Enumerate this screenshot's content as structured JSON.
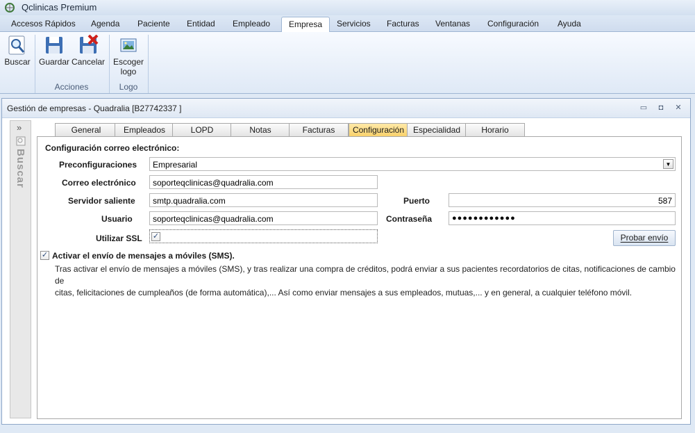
{
  "app": {
    "title": "Qclinicas Premium"
  },
  "menu": [
    "Accesos Rápidos",
    "Agenda",
    "Paciente",
    "Entidad",
    "Empleado",
    "Empresa",
    "Servicios",
    "Facturas",
    "Ventanas",
    "Configuración",
    "Ayuda"
  ],
  "ribbon": {
    "buscar": "Buscar",
    "guardar": "Guardar",
    "cancelar": "Cancelar",
    "escoger_line1": "Escoger",
    "escoger_line2": "logo",
    "group_acciones": "Acciones",
    "group_logo": "Logo"
  },
  "doc": {
    "title": "Gestión de empresas - Quadralia  [B27742337 ]",
    "side_label": "Buscar",
    "side_arrows": "»"
  },
  "tabs": [
    "General",
    "Empleados",
    "LOPD",
    "Notas",
    "Facturas",
    "Configuración",
    "Especialidad",
    "Horario"
  ],
  "form": {
    "section_title": "Configuración correo electrónico:",
    "preconf_label": "Preconfiguraciones",
    "preconf_value": "Empresarial",
    "correo_label": "Correo electrónico",
    "correo_value": "soporteqclinicas@quadralia.com",
    "servidor_label": "Servidor saliente",
    "servidor_value": "smtp.quadralia.com",
    "puerto_label": "Puerto",
    "puerto_value": "587",
    "usuario_label": "Usuario",
    "usuario_value": "soporteqclinicas@quadralia.com",
    "contrasena_label": "Contraseña",
    "contrasena_value": "●●●●●●●●●●●●",
    "ssl_label": "Utilizar SSL",
    "probar_label": "Probar envío",
    "sms_label": "Activar el envío de mensajes a móviles (SMS).",
    "sms_info_line1": "Tras activar el envío de mensajes a móviles (SMS), y tras realizar una compra de créditos, podrá enviar a sus pacientes recordatorios de citas, notificaciones de cambio de",
    "sms_info_line2": "citas, felicitaciones de cumpleaños (de forma automática),... Así como enviar mensajes a sus empleados, mutuas,... y en general, a cualquier teléfono móvil."
  },
  "check_mark": "✓",
  "colors": {
    "active_tab": "#f9d26c",
    "ribbon": "#dfe9f6",
    "window_border": "#8ea7c8"
  }
}
